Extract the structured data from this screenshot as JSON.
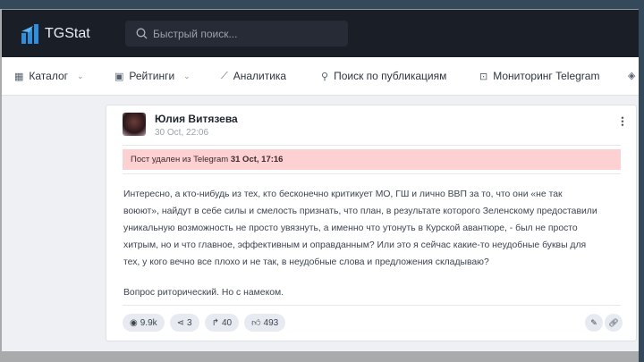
{
  "app": {
    "logo_text": "TGStat",
    "search_placeholder": "Быстрый поиск..."
  },
  "nav": [
    {
      "label": "Каталог",
      "icon": "grid-icon",
      "dropdown": true
    },
    {
      "label": "Рейтинги",
      "icon": "rating-icon",
      "dropdown": true
    },
    {
      "label": "Аналитика",
      "icon": "chart-line-icon"
    },
    {
      "label": "Поиск по публикациям",
      "icon": "search-key-icon"
    },
    {
      "label": "Мониторинг Telegram",
      "icon": "monitor-icon"
    }
  ],
  "post": {
    "author": "Юлия Витязева",
    "date": "30 Oct, 22:06",
    "deleted_prefix": "Пост удален из Telegram",
    "deleted_date": "31 Oct, 17:16",
    "lines": [
      "Интересно, а кто-нибудь из тех, кто бесконечно критикует МО, ГШ и лично ВВП за то, что они «не так",
      "воюют», найдут в себе силы и смелость признать, что план, в результате которого Зеленскому предоставили",
      "уникальную возможность не просто увязнуть, а именно что утонуть в Курской авантюре, - был не просто",
      "хитрым, но и что главное, эффективным и оправданным? Или это я сейчас какие-то неудобные буквы для",
      "тех, у кого вечно все плохо и не так, в неудобные слова и предложения складываю?"
    ],
    "closing": "Вопрос риторический. Но с намеком.",
    "stats": {
      "views": "9.9k",
      "shares": "3",
      "forwards": "40",
      "reactions": "493"
    }
  }
}
